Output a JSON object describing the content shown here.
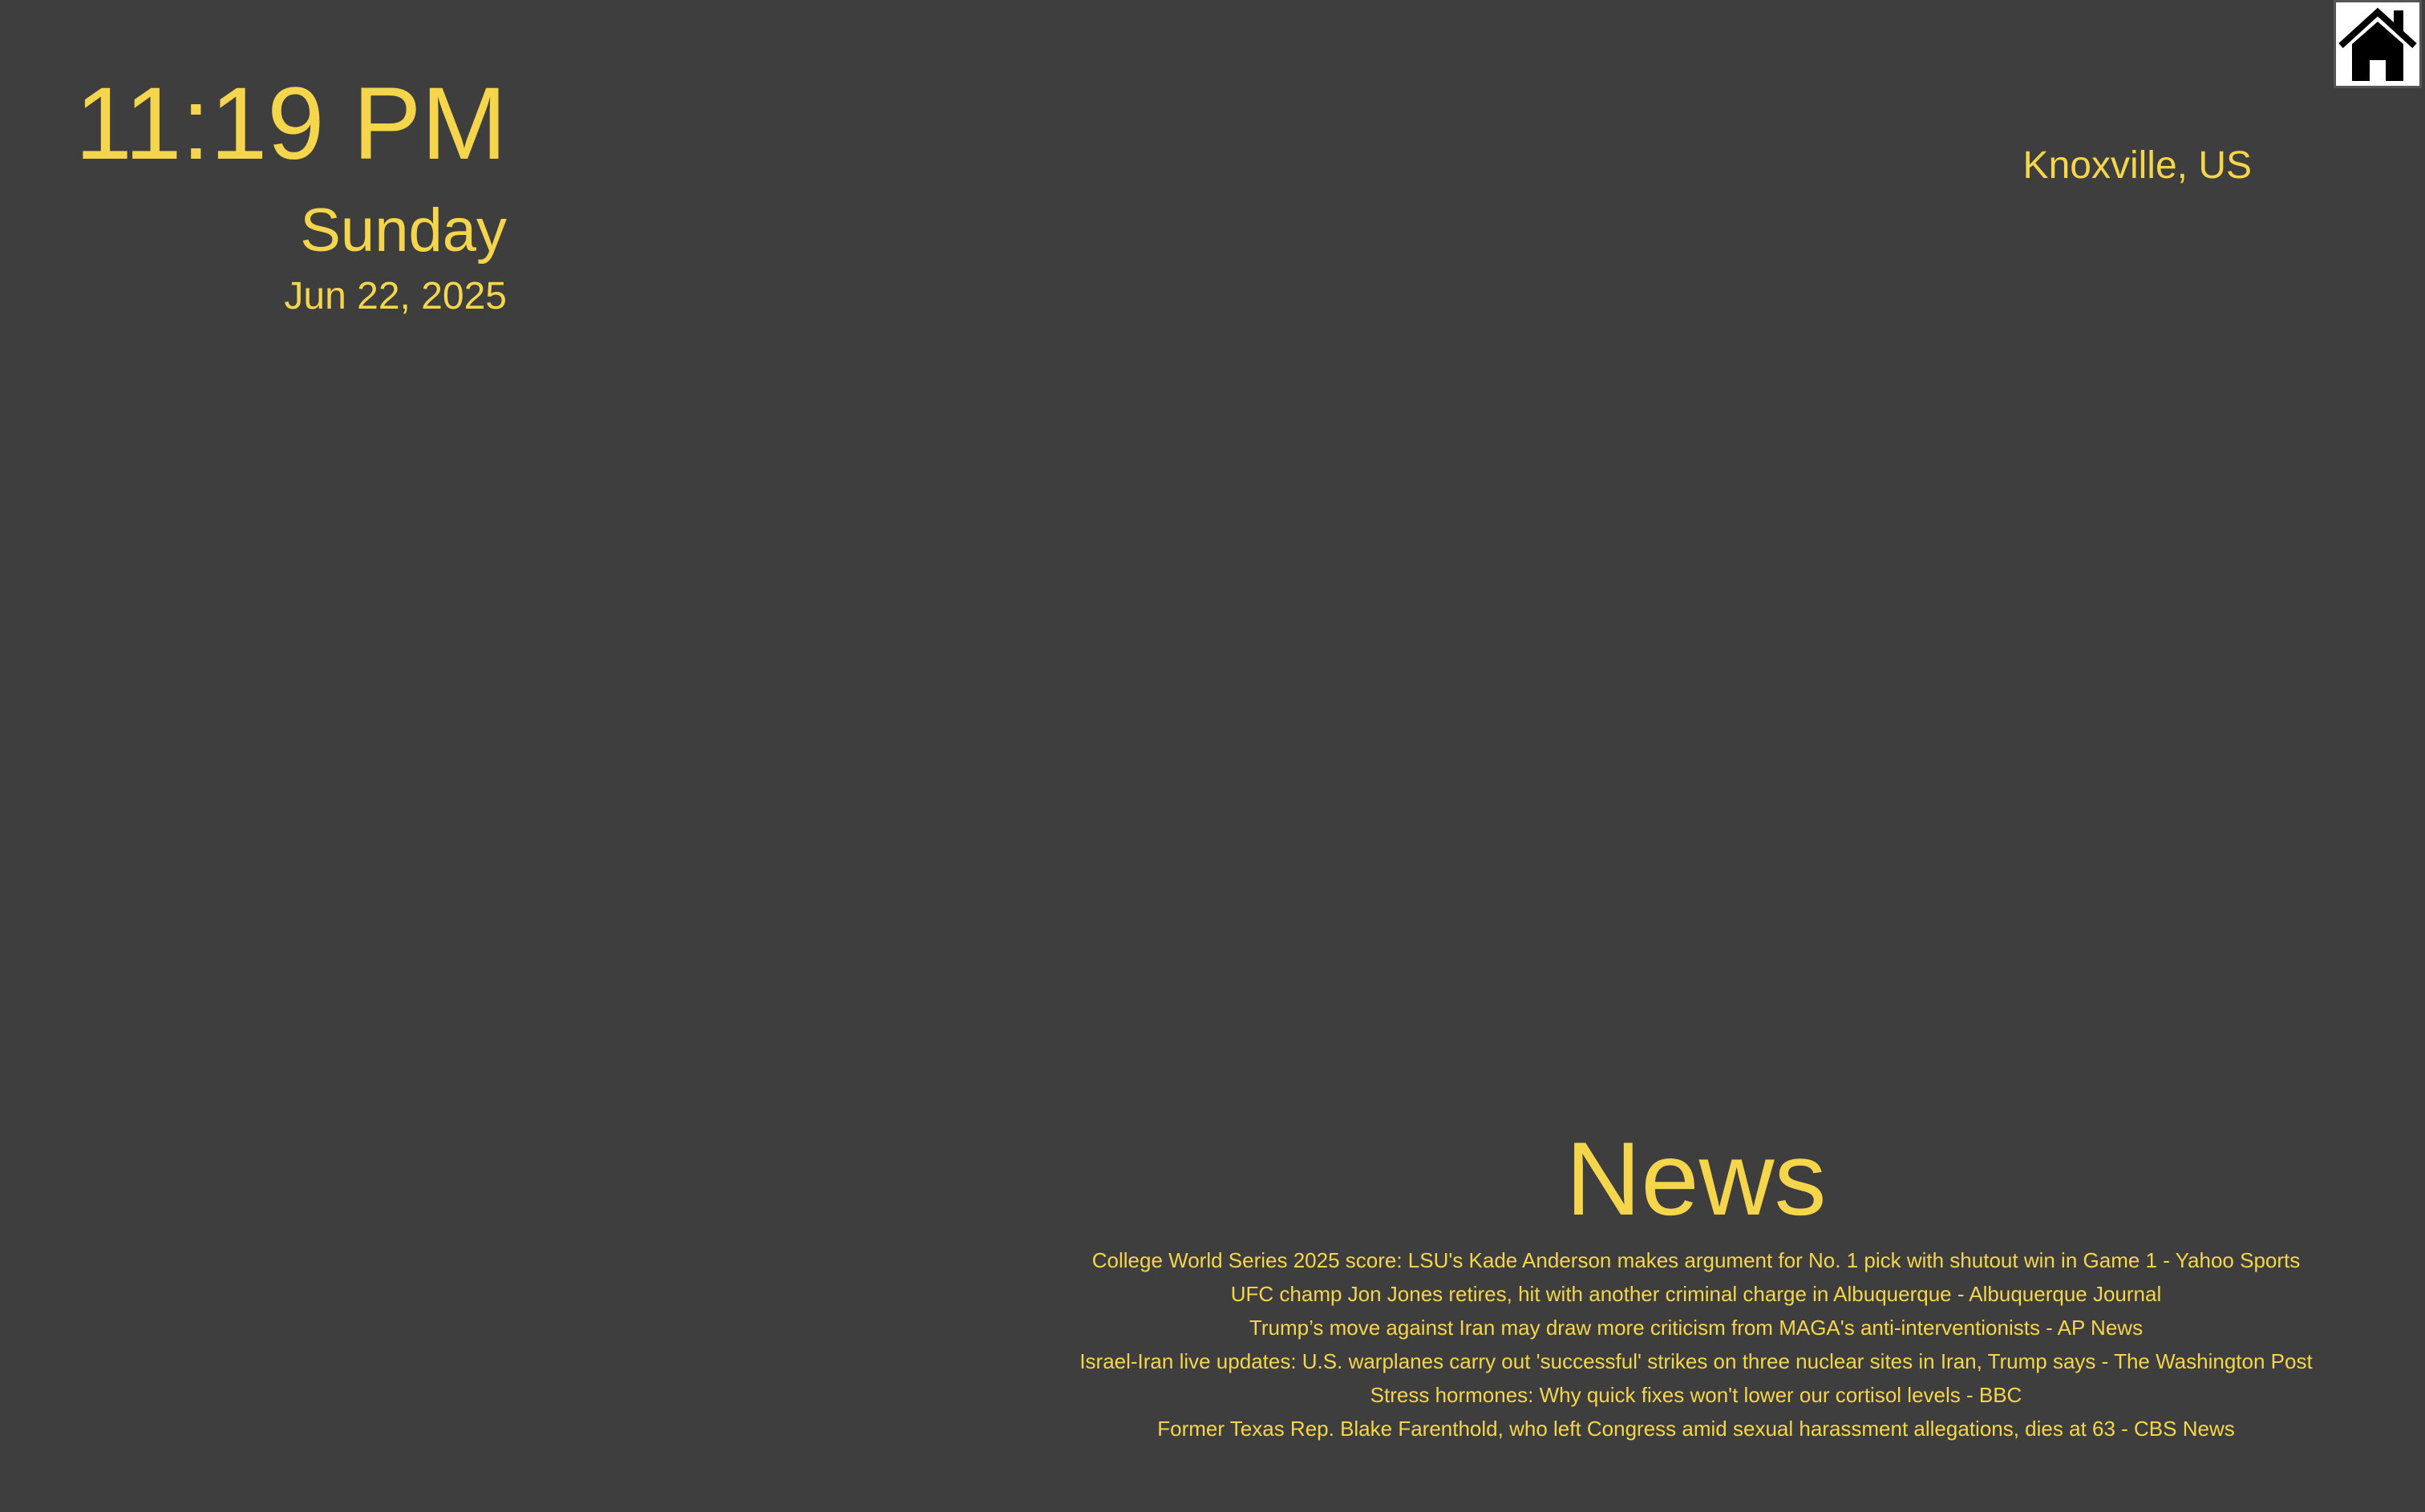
{
  "clock": {
    "time": "11:19 PM",
    "day": "Sunday",
    "date": "Jun 22, 2025"
  },
  "location": {
    "text": "Knoxville, US"
  },
  "home": {
    "icon": "home-icon"
  },
  "news": {
    "title": "News",
    "items": [
      "College World Series 2025 score: LSU's Kade Anderson makes argument for No. 1 pick with shutout win in Game 1 - Yahoo Sports",
      "UFC champ Jon Jones retires, hit with another criminal charge in Albuquerque - Albuquerque Journal",
      "Trump’s move against Iran may draw more criticism from MAGA's anti-interventionists - AP News",
      "Israel-Iran live updates: U.S. warplanes carry out 'successful' strikes on three nuclear sites in Iran, Trump says - The Washington Post",
      "Stress hormones: Why quick fixes won't lower our cortisol levels - BBC",
      "Former Texas Rep. Blake Farenthold, who left Congress amid sexual harassment allegations, dies at 63 - CBS News"
    ]
  },
  "colors": {
    "background": "#3e3e3e",
    "accent": "#f5d54b"
  }
}
